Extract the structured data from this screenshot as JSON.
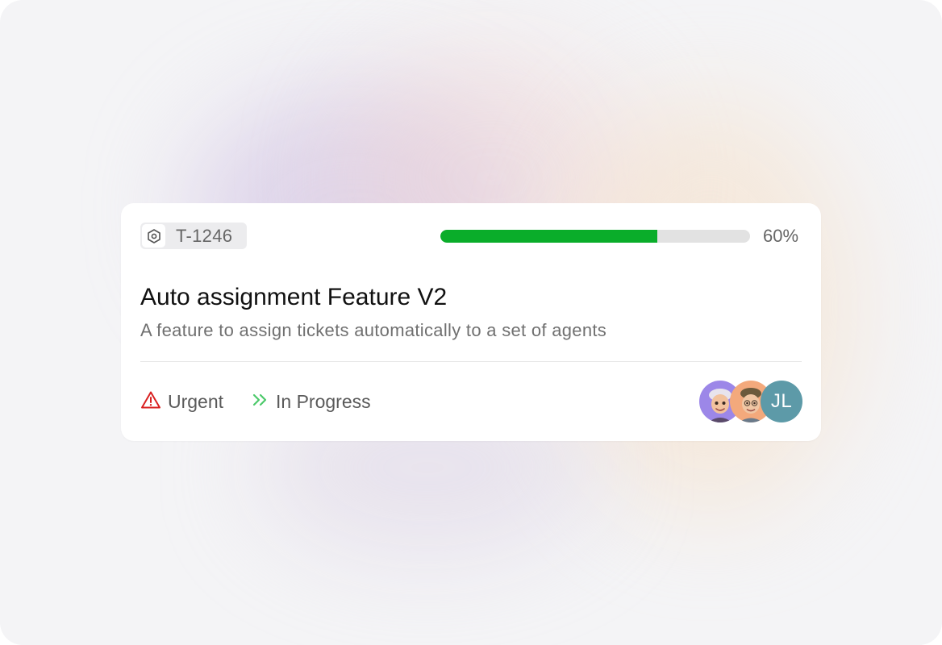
{
  "ticket": {
    "id": "T-1246",
    "icon": "hexagon-nut-icon"
  },
  "progress": {
    "value": 0.7,
    "label": "60%",
    "fill_color": "#0aad2a",
    "track_color": "#e2e2e2"
  },
  "task": {
    "title": "Auto assignment Feature V2",
    "description": "A feature to assign tickets automatically to a set of agents"
  },
  "priority": {
    "label": "Urgent",
    "icon": "warning-triangle-icon",
    "color": "#d92020"
  },
  "status": {
    "label": "In Progress",
    "icon": "double-chevron-right-icon",
    "color": "#4cc96a"
  },
  "assignees": [
    {
      "type": "memoji",
      "icon": "avatar-memoji-icon",
      "bg": "#9c87e8"
    },
    {
      "type": "memoji",
      "icon": "avatar-memoji-icon",
      "bg": "#f3a97c"
    },
    {
      "type": "initials",
      "initials": "JL",
      "bg": "#5d9aa8"
    }
  ]
}
